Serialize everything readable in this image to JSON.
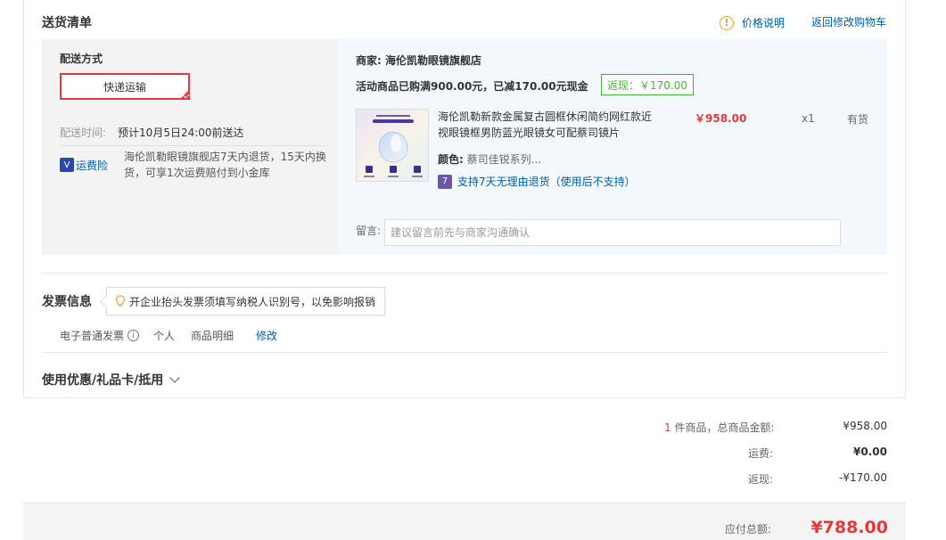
{
  "section_title": "送货清单",
  "price_help": "价格说明",
  "back_to_cart": "返回修改购物车",
  "shipping": {
    "label": "配送方式",
    "method": "快递运输",
    "time_label": "配送时间:",
    "time_value": "预计10月5日24:00前送达",
    "freight_insurance": "运费险",
    "freight_desc": "海伦凯勒眼镜旗舰店7天内退货，15天内换货，可享1次运费赔付到小金库"
  },
  "shop": {
    "label": "商家:",
    "name": "海伦凯勒眼镜旗舰店",
    "promo": "活动商品已购满900.00元，已减170.00元现金",
    "rebate": "返现：￥170.00"
  },
  "product": {
    "name": "海伦凯勒新款金属复古圆框休闲简约网红款近视眼镜框男防蓝光眼镜女可配蔡司镜片",
    "price": "￥958.00",
    "qty": "x1",
    "stock": "有货",
    "color_label": "颜色:",
    "color_value": "蔡司佳锐系列...",
    "return_policy": "支持7天无理由退货（使用后不支持）",
    "return_badge": "7"
  },
  "note": {
    "label": "留言:",
    "placeholder": "建议留言前先与商家沟通确认"
  },
  "invoice": {
    "title": "发票信息",
    "tip": "开企业抬头发票须填写纳税人识别号，以免影响报销",
    "type": "电子普通发票",
    "info_icon": "i",
    "owner": "个人",
    "content": "商品明细",
    "edit": "修改"
  },
  "coupon_title": "使用优惠/礼品卡/抵用",
  "summary": {
    "count": "1",
    "goods_label": "件商品，总商品金额:",
    "goods_value": "¥958.00",
    "freight_label": "运费:",
    "freight_value": "¥0.00",
    "rebate_label": "返现:",
    "rebate_value": "-¥170.00",
    "total_label": "应付总额:",
    "total_value": "¥788.00"
  },
  "icons": {
    "warn": "!",
    "shield": "V"
  },
  "colors": {
    "accent_red": "#e4393c",
    "link_blue": "#005ea7",
    "rebate_green": "#4ab23c"
  }
}
